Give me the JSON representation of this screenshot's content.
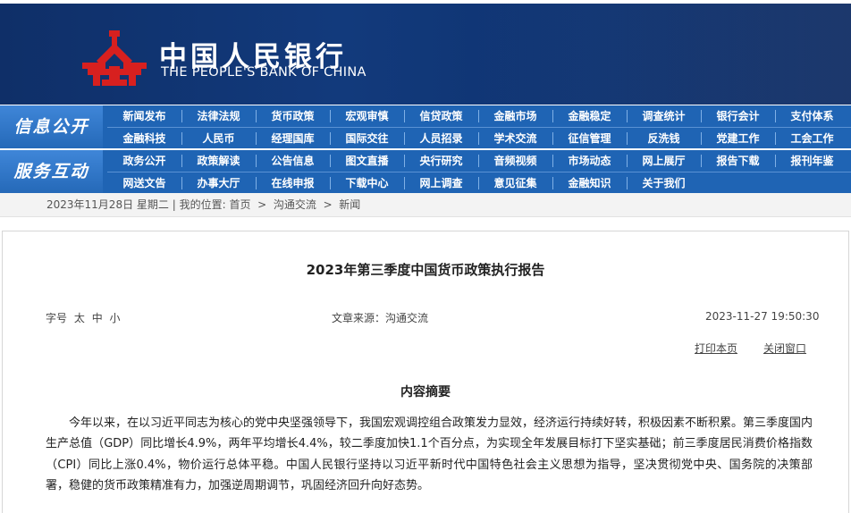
{
  "banner": {
    "name_cn": "中国人民银行",
    "name_en": "THE PEOPLE'S BANK OF CHINA",
    "brand_color": "#d7201f"
  },
  "nav_info": {
    "label": "信息公开",
    "row1": [
      "新闻发布",
      "法律法规",
      "货币政策",
      "宏观审慎",
      "信贷政策",
      "金融市场",
      "金融稳定",
      "调查统计",
      "银行会计",
      "支付体系"
    ],
    "row2": [
      "金融科技",
      "人民币",
      "经理国库",
      "国际交往",
      "人员招录",
      "学术交流",
      "征信管理",
      "反洗钱",
      "党建工作",
      "工会工作"
    ]
  },
  "nav_service": {
    "label": "服务互动",
    "row1": [
      "政务公开",
      "政策解读",
      "公告信息",
      "图文直播",
      "央行研究",
      "音频视频",
      "市场动态",
      "网上展厅",
      "报告下载",
      "报刊年鉴"
    ],
    "row2": [
      "网送文告",
      "办事大厅",
      "在线申报",
      "下载中心",
      "网上调查",
      "意见征集",
      "金融知识",
      "关于我们"
    ]
  },
  "breadcrumb": {
    "date": "2023年11月28日",
    "weekday": "星期二",
    "location_label": "我的位置:",
    "home": "首页",
    "sep": ">",
    "level1": "沟通交流",
    "level2": "新闻"
  },
  "article": {
    "title": "2023年第三季度中国货币政策执行报告",
    "fontsize_label": "字号",
    "font_large": "太",
    "font_medium": "中",
    "font_small": "小",
    "source": "文章来源：沟通交流",
    "datetime": "2023-11-27 19:50:30",
    "print_link": "打印本页",
    "close_link": "关闭窗口",
    "subheading": "内容摘要",
    "paragraph": "今年以来，在以习近平同志为核心的党中央坚强领导下，我国宏观调控组合政策发力显效，经济运行持续好转，积极因素不断积累。第三季度国内生产总值（GDP）同比增长4.9%，两年平均增长4.4%，较二季度加快1.1个百分点，为实现全年发展目标打下坚实基础；前三季度居民消费价格指数（CPI）同比上涨0.4%，物价运行总体平稳。中国人民银行坚持以习近平新时代中国特色社会主义思想为指导，坚决贯彻党中央、国务院的决策部署，稳健的货币政策精准有力，加强逆周期调节，巩固经济回升向好态势。"
  }
}
